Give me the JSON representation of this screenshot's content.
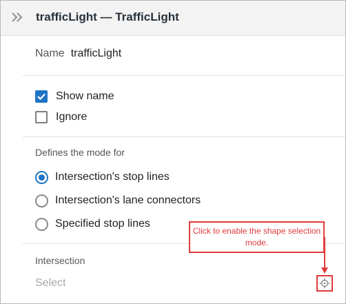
{
  "panel": {
    "title": "trafficLight — TrafficLight",
    "name_label": "Name",
    "name_value": "trafficLight"
  },
  "checkboxes": [
    {
      "label": "Show name",
      "checked": true
    },
    {
      "label": "Ignore",
      "checked": false
    }
  ],
  "mode": {
    "heading": "Defines the mode for",
    "options": [
      {
        "label": "Intersection's stop lines",
        "selected": true
      },
      {
        "label": "Intersection's lane connectors",
        "selected": false
      },
      {
        "label": "Specified stop lines",
        "selected": false
      }
    ]
  },
  "intersection": {
    "heading": "Intersection",
    "select_placeholder": "Select"
  },
  "callout": {
    "text": "Click to enable the shape selection mode."
  },
  "icons": {
    "collapse": "double-chevron-right-icon",
    "pick": "crosshair-target-icon",
    "check": "checkmark-icon"
  },
  "colors": {
    "accent": "#1f74c4",
    "callout": "#e13a3a",
    "header_bg": "#f3f3f3"
  }
}
